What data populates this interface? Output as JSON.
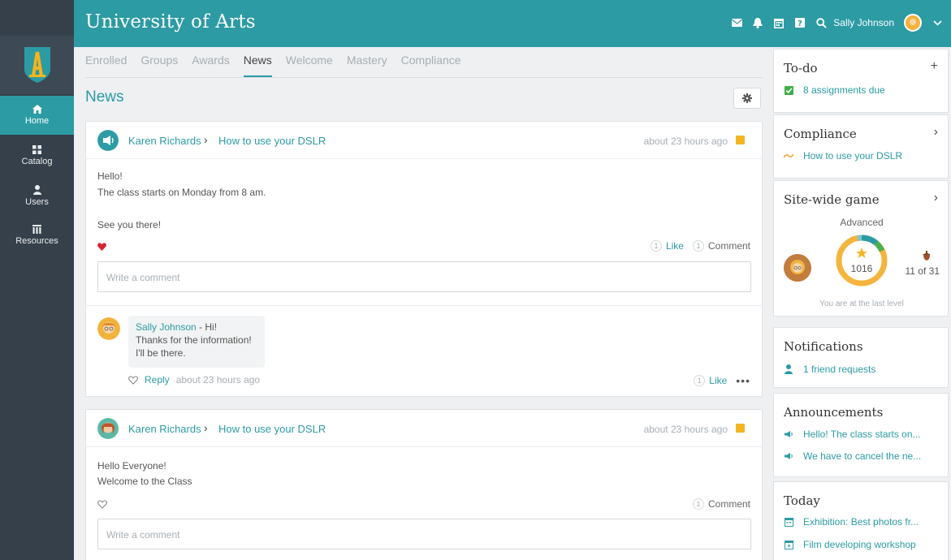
{
  "app": {
    "title": "University of Arts"
  },
  "topbar": {
    "user_name": "Sally Johnson",
    "icons": [
      "mail-icon",
      "bell-icon",
      "calendar-icon",
      "help-icon",
      "search-icon",
      "chevron-down-icon"
    ]
  },
  "sidebar": {
    "items": [
      {
        "label": "Home",
        "icon": "home-icon",
        "active": true
      },
      {
        "label": "Catalog",
        "icon": "grid-icon"
      },
      {
        "label": "Users",
        "icon": "user-icon"
      },
      {
        "label": "Resources",
        "icon": "library-icon"
      }
    ]
  },
  "tabs": [
    {
      "label": "Enrolled"
    },
    {
      "label": "Groups"
    },
    {
      "label": "Awards"
    },
    {
      "label": "News",
      "active": true
    },
    {
      "label": "Welcome"
    },
    {
      "label": "Mastery"
    },
    {
      "label": "Compliance"
    }
  ],
  "news": {
    "title": "News",
    "posts": [
      {
        "author": "Karen Richards",
        "course": "How to use your DSLR",
        "time": "about 23 hours ago",
        "lines": [
          "Hello!",
          "The class starts on Monday from 8 am.",
          "See you there!"
        ],
        "likes_count": "1",
        "like_label": "Like",
        "comments_count": "1",
        "comment_label": "Comment",
        "comment_placeholder": "Write a comment",
        "reply": {
          "author": "Sally Johnson",
          "first_line": " - Hi!",
          "lines": [
            "Thanks for the information!",
            "I'll be there."
          ],
          "reply_label": "Reply",
          "time": "about 23 hours ago",
          "likes_count": "1",
          "like_label": "Like",
          "more": "•••"
        }
      },
      {
        "author": "Karen Richards",
        "course": "How to use your DSLR",
        "time": "about 23 hours ago",
        "lines": [
          "Hello Everyone!",
          "Welcome to the Class"
        ],
        "comments_count": "1",
        "comment_label": "Comment",
        "comment_placeholder": "Write a comment"
      }
    ]
  },
  "todo": {
    "title": "To-do",
    "action": "+",
    "items": [
      "8 assignments due"
    ]
  },
  "compliance": {
    "title": "Compliance",
    "action": "›",
    "items": [
      "How to use your DSLR"
    ]
  },
  "game": {
    "title": "Site-wide game",
    "action": "›",
    "level": "Advanced",
    "points": "1016",
    "rank": "11 of 31",
    "footer": "You are at the last level",
    "progress": 1.0
  },
  "notifications": {
    "title": "Notifications",
    "items": [
      "1 friend requests"
    ]
  },
  "announcements": {
    "title": "Announcements",
    "items": [
      "Hello! The class starts on...",
      "We have to cancel the ne..."
    ]
  },
  "today": {
    "title": "Today",
    "items": [
      "Exhibition: Best photos fr...",
      "Film developing workshop"
    ]
  },
  "colors": {
    "accent": "#2c9ba3",
    "sidebar": "#35404a",
    "flag": "#f2b622",
    "heart": "#d0282e",
    "ring": "#f5b43c"
  }
}
